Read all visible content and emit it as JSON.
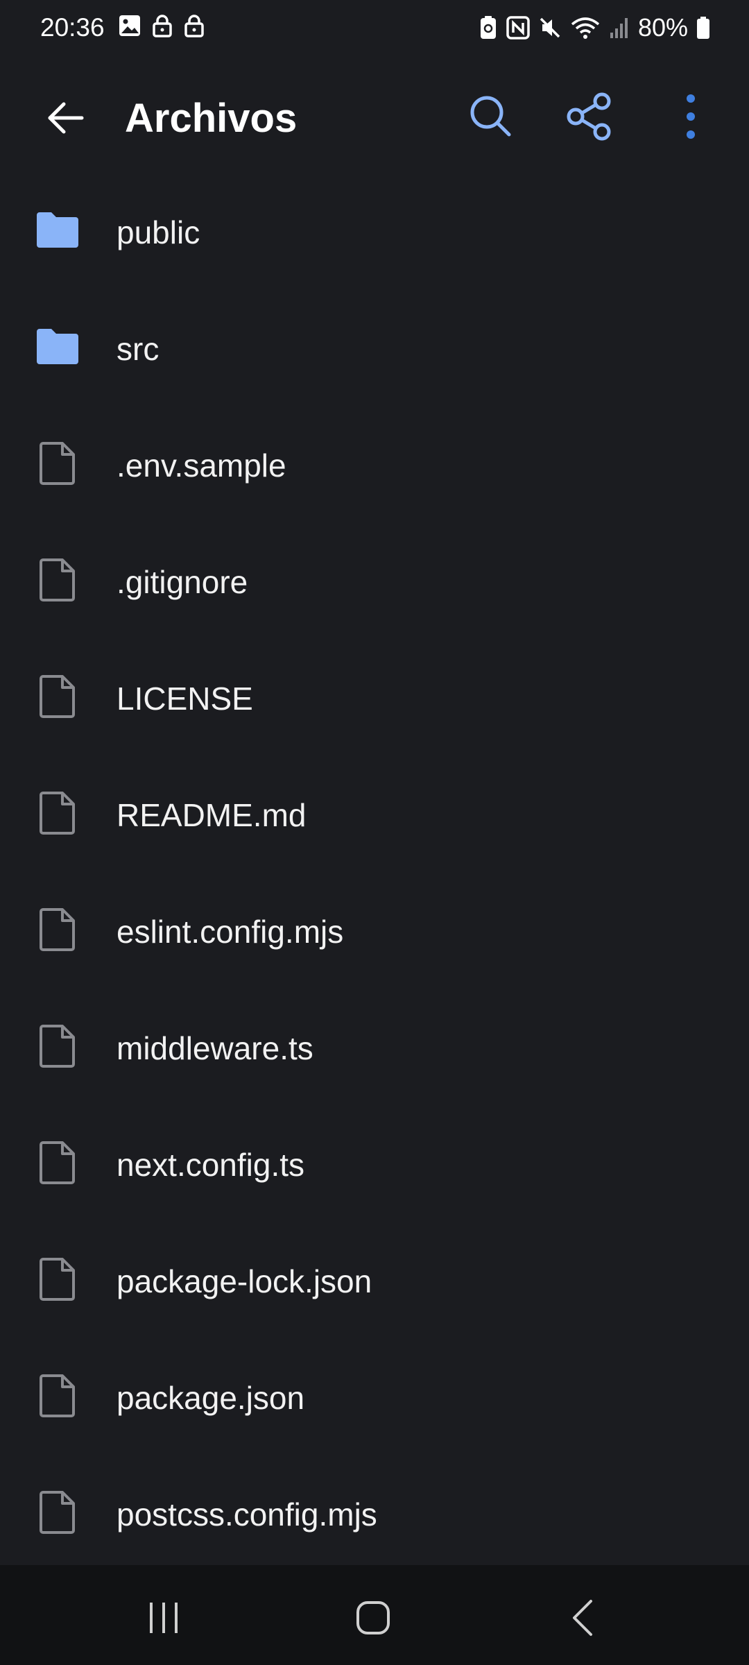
{
  "status_bar": {
    "time": "20:36",
    "battery": "80%",
    "left_icons": [
      "gallery-icon",
      "lock-icon",
      "lock-icon"
    ],
    "right_icons": [
      "nfc-share-icon",
      "nfc-icon",
      "mute-icon",
      "wifi-icon",
      "signal-icon",
      "battery-icon"
    ]
  },
  "app_bar": {
    "title": "Archivos",
    "icons": {
      "back": "arrow-left-icon",
      "search": "search-icon",
      "share": "share-icon",
      "more": "more-vert-icon"
    }
  },
  "colors": {
    "background": "#1b1c20",
    "nav_background": "#111214",
    "accent": "#8ab4f8",
    "folder": "#8ab4f8",
    "file_icon": "#8a8b90"
  },
  "files": [
    {
      "name": "public",
      "type": "folder"
    },
    {
      "name": "src",
      "type": "folder"
    },
    {
      "name": ".env.sample",
      "type": "file"
    },
    {
      "name": ".gitignore",
      "type": "file"
    },
    {
      "name": "LICENSE",
      "type": "file"
    },
    {
      "name": "README.md",
      "type": "file"
    },
    {
      "name": "eslint.config.mjs",
      "type": "file"
    },
    {
      "name": "middleware.ts",
      "type": "file"
    },
    {
      "name": "next.config.ts",
      "type": "file"
    },
    {
      "name": "package-lock.json",
      "type": "file"
    },
    {
      "name": "package.json",
      "type": "file"
    },
    {
      "name": "postcss.config.mjs",
      "type": "file"
    }
  ],
  "nav_bar": {
    "icons": [
      "recent-apps-icon",
      "home-icon",
      "back-icon"
    ]
  }
}
